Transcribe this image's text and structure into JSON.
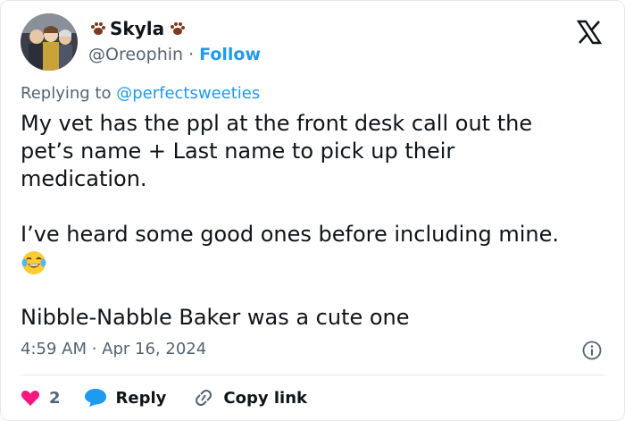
{
  "author": {
    "display_name": "Skyla",
    "handle": "@Oreophin",
    "separator": "·",
    "follow_label": "Follow"
  },
  "replying": {
    "prefix": "Replying to",
    "mention": "@perfectsweeties"
  },
  "tweet": {
    "line1": "My vet has the ppl at the front desk call out the",
    "line2": "pet’s name + Last name to pick up their",
    "line3": "medication.",
    "line4": "I’ve heard some good ones before including mine.",
    "line5": "Nibble-Nabble Baker was a cute one"
  },
  "timestamp": "4:59 AM · Apr 16, 2024",
  "actions": {
    "like_count": "2",
    "reply_label": "Reply",
    "copy_link_label": "Copy link"
  },
  "colors": {
    "accent": "#1d9bf0",
    "like": "#f91880",
    "muted": "#536471",
    "text": "#0f1419"
  },
  "icons": [
    "paw-icon",
    "x-logo-icon",
    "joy-emoji",
    "info-icon",
    "heart-icon",
    "reply-bubble-icon",
    "link-icon"
  ]
}
